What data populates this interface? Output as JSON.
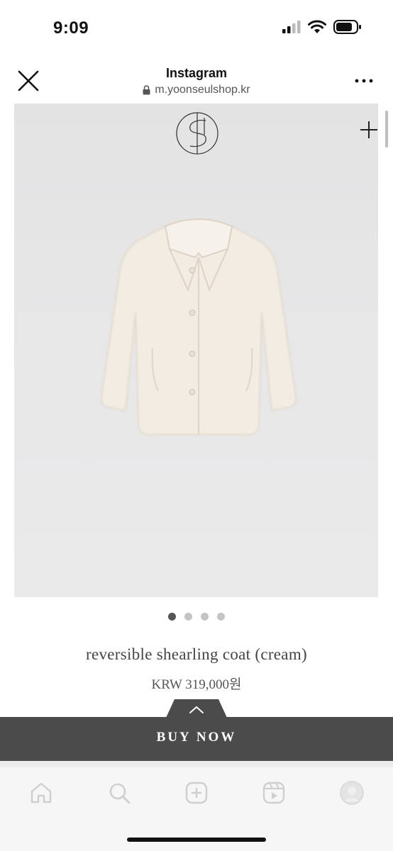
{
  "status_bar": {
    "time": "9:09"
  },
  "browser": {
    "title": "Instagram",
    "url": "m.yoonseulshop.kr"
  },
  "carousel": {
    "count": 4,
    "active_index": 0
  },
  "product": {
    "name": "reversible shearling coat (cream)",
    "price": "KRW 319,000원"
  },
  "buy": {
    "label": "BUY NOW"
  },
  "tab_bar": {
    "items": [
      "home-icon",
      "search-icon",
      "create-icon",
      "reels-icon",
      "profile-avatar"
    ]
  },
  "colors": {
    "buy_bar": "#4b4b4b",
    "image_bg": "#e6e6e7",
    "coat": "#f2ece3",
    "dot_active": "#555555",
    "dot_inactive": "#c4c4c4"
  }
}
